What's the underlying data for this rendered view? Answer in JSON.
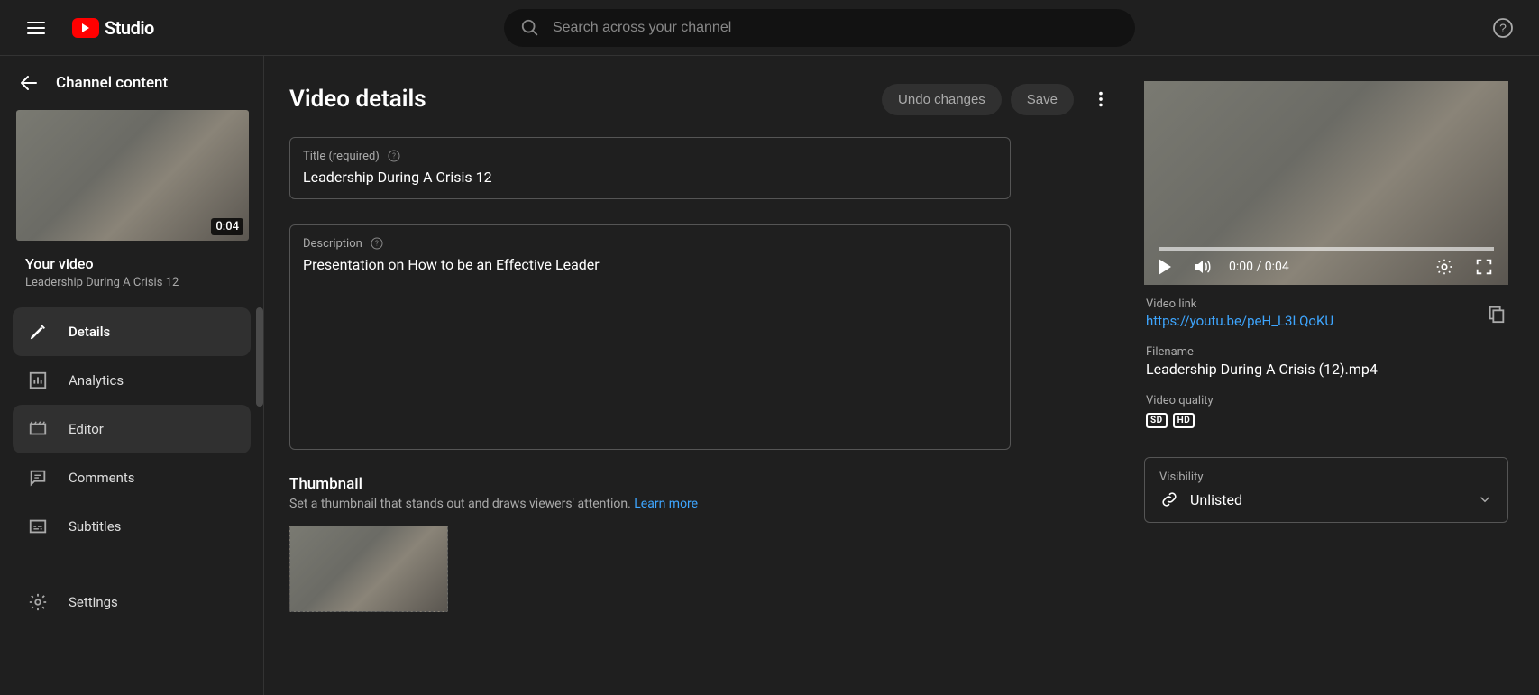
{
  "header": {
    "logo_text": "Studio",
    "search_placeholder": "Search across your channel"
  },
  "sidebar": {
    "title": "Channel content",
    "duration": "0:04",
    "your_video_label": "Your video",
    "video_title": "Leadership During A Crisis 12",
    "items": [
      {
        "label": "Details"
      },
      {
        "label": "Analytics"
      },
      {
        "label": "Editor"
      },
      {
        "label": "Comments"
      },
      {
        "label": "Subtitles"
      },
      {
        "label": "Settings"
      }
    ]
  },
  "page": {
    "title": "Video details",
    "undo_label": "Undo changes",
    "save_label": "Save"
  },
  "fields": {
    "title_label": "Title (required)",
    "title_value": "Leadership During A Crisis 12",
    "desc_label": "Description",
    "desc_value": "Presentation on How to be an Effective Leader"
  },
  "thumbnail": {
    "heading": "Thumbnail",
    "help": "Set a thumbnail that stands out and draws viewers' attention. ",
    "learn_more": "Learn more"
  },
  "preview": {
    "time": "0:00 / 0:04"
  },
  "meta": {
    "link_label": "Video link",
    "link": "https://youtu.be/peH_L3LQoKU",
    "filename_label": "Filename",
    "filename": "Leadership During A Crisis (12).mp4",
    "quality_label": "Video quality",
    "sd": "SD",
    "hd": "HD"
  },
  "visibility": {
    "label": "Visibility",
    "value": "Unlisted"
  }
}
